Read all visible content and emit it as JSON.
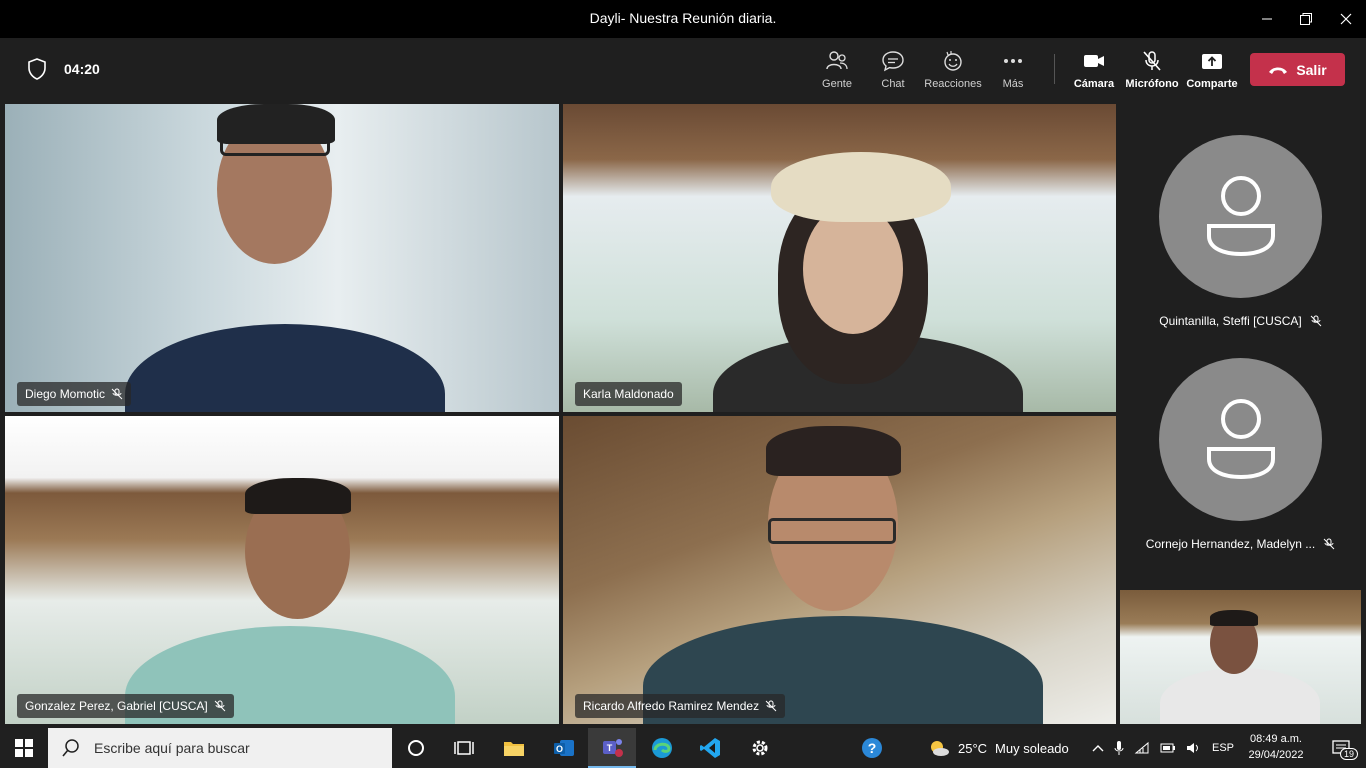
{
  "window": {
    "title": "Dayli- Nuestra Reunión diaria."
  },
  "toolbar": {
    "timer": "04:20",
    "buttons": [
      {
        "label": "Gente",
        "icon": "people-icon"
      },
      {
        "label": "Chat",
        "icon": "chat-icon"
      },
      {
        "label": "Reacciones",
        "icon": "reactions-icon"
      },
      {
        "label": "Más",
        "icon": "more-icon"
      },
      {
        "label": "Cámara",
        "icon": "camera-icon"
      },
      {
        "label": "Micrófono",
        "icon": "microphone-muted-icon"
      },
      {
        "label": "Comparte",
        "icon": "share-icon"
      }
    ],
    "leave_label": "Salir"
  },
  "participants": {
    "video": [
      {
        "name": "Diego Momotic",
        "muted": true
      },
      {
        "name": "Karla Maldonado",
        "muted": false
      },
      {
        "name": "Gonzalez Perez, Gabriel [CUSCA]",
        "muted": true
      },
      {
        "name": "Ricardo Alfredo Ramirez Mendez",
        "muted": true
      }
    ],
    "avatars": [
      {
        "name": "Quintanilla, Steffi [CUSCA]",
        "muted": true
      },
      {
        "name": "Cornejo Hernandez, Madelyn ...",
        "muted": true
      }
    ]
  },
  "taskbar": {
    "search_placeholder": "Escribe aquí para buscar",
    "weather_temp": "25°C",
    "weather_text": "Muy soleado",
    "language": "ESP",
    "time": "08:49 a.m.",
    "date": "29/04/2022",
    "notifications": "19"
  }
}
